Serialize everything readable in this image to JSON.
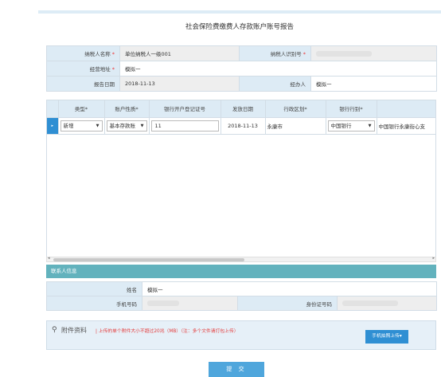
{
  "page": {
    "title": "社会保险费缴费人存款账户账号报告"
  },
  "form": {
    "taxpayer_name_label": "纳税人名称",
    "taxpayer_name_value": "单位纳税人一级001",
    "taxpayer_id_label": "纳税人识别号",
    "address_label": "经营地址",
    "address_value": "模拟一",
    "report_date_label": "报告日期",
    "report_date_value": "2018-11-13",
    "handler_label": "经办人",
    "handler_value": "模拟一",
    "required_mark": "*"
  },
  "grid": {
    "columns": [
      "类型*",
      "账户性质*",
      "银行开户登记证号",
      "发放日期",
      "行政区划*",
      "银行行别*",
      ""
    ],
    "row": {
      "selector": "▸",
      "type": "新增",
      "account_nature": "基本存款账",
      "bank_reg_no": "11",
      "issue_date": "2018-11-13",
      "region": "永康市",
      "bank_type": "中国银行",
      "bank_branch": "中国银行永康街心支"
    }
  },
  "scroll": {
    "left_arrow": "◂",
    "right_arrow": "▸"
  },
  "contact": {
    "header": "联系人信息",
    "name_label": "姓名",
    "name_value": "模拟一",
    "phone_label": "手机号码",
    "id_label": "身份证号码"
  },
  "attachments": {
    "title": "附件资料",
    "note": "| 上传的单个附件大小不超过20兆（MB）（注：多个文件请打包上传）",
    "upload_button": "手机拍照上传▾"
  },
  "submit_button": "提 交",
  "colors": {
    "accent": "#2f8fd3",
    "header_bg": "#ddebf5",
    "contact_header": "#62b2bd",
    "warning": "#e43a3a"
  }
}
